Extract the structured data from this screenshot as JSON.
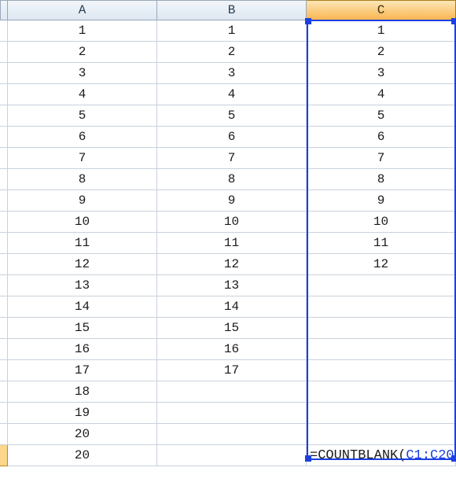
{
  "columns": [
    "A",
    "B",
    "C"
  ],
  "rows": [
    {
      "a": "1",
      "b": "1",
      "c": "1"
    },
    {
      "a": "2",
      "b": "2",
      "c": "2"
    },
    {
      "a": "3",
      "b": "3",
      "c": "3"
    },
    {
      "a": "4",
      "b": "4",
      "c": "4"
    },
    {
      "a": "5",
      "b": "5",
      "c": "5"
    },
    {
      "a": "6",
      "b": "6",
      "c": "6"
    },
    {
      "a": "7",
      "b": "7",
      "c": "7"
    },
    {
      "a": "8",
      "b": "8",
      "c": "8"
    },
    {
      "a": "9",
      "b": "9",
      "c": "9"
    },
    {
      "a": "10",
      "b": "10",
      "c": "10"
    },
    {
      "a": "11",
      "b": "11",
      "c": "11"
    },
    {
      "a": "12",
      "b": "12",
      "c": "12"
    },
    {
      "a": "13",
      "b": "13",
      "c": ""
    },
    {
      "a": "14",
      "b": "14",
      "c": ""
    },
    {
      "a": "15",
      "b": "15",
      "c": ""
    },
    {
      "a": "16",
      "b": "16",
      "c": ""
    },
    {
      "a": "17",
      "b": "17",
      "c": ""
    },
    {
      "a": "18",
      "b": "",
      "c": ""
    },
    {
      "a": "19",
      "b": "",
      "c": ""
    },
    {
      "a": "20",
      "b": "",
      "c": ""
    }
  ],
  "bottom_row": {
    "a": "20",
    "b": "",
    "formula_prefix": "=COUNTBLANK",
    "formula_open": "(",
    "formula_ref": "C1:C20",
    "formula_close": ")"
  },
  "active_column_index": 2,
  "selection_range": "C1:C20",
  "colors": {
    "header_active_bg": "#f9b651",
    "reference_blue": "#1b3fe0"
  }
}
